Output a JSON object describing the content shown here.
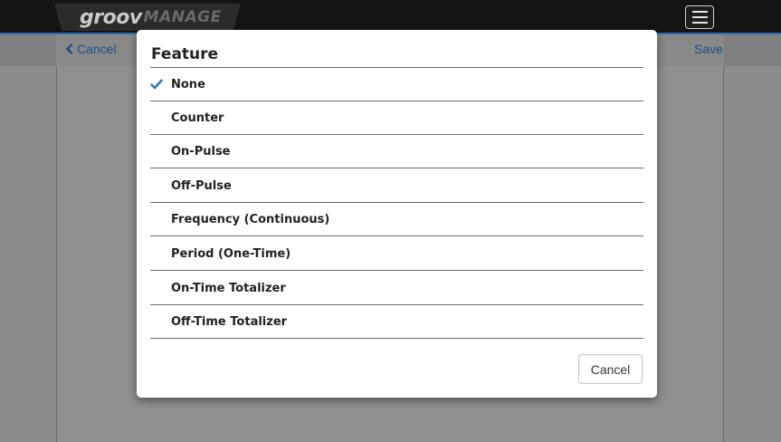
{
  "header": {
    "logo_part1": "groov",
    "logo_part2": "MANAGE",
    "menu_icon": "hamburger-icon"
  },
  "toolbar": {
    "cancel_label": "Cancel",
    "save_label": "Save",
    "cancel_icon": "chevron-left-icon"
  },
  "dialog": {
    "title": "Feature",
    "selected": "None",
    "check_icon": "checkmark-icon",
    "options": [
      {
        "label": "None",
        "selected": true
      },
      {
        "label": "Counter",
        "selected": false
      },
      {
        "label": "On-Pulse",
        "selected": false
      },
      {
        "label": "Off-Pulse",
        "selected": false
      },
      {
        "label": "Frequency (Continuous)",
        "selected": false
      },
      {
        "label": "Period (One-Time)",
        "selected": false
      },
      {
        "label": "On-Time Totalizer",
        "selected": false
      },
      {
        "label": "Off-Time Totalizer",
        "selected": false
      }
    ],
    "cancel_label": "Cancel"
  },
  "colors": {
    "accent": "#2a6fb5",
    "link": "#1f4f88",
    "check": "#2f78c4"
  }
}
